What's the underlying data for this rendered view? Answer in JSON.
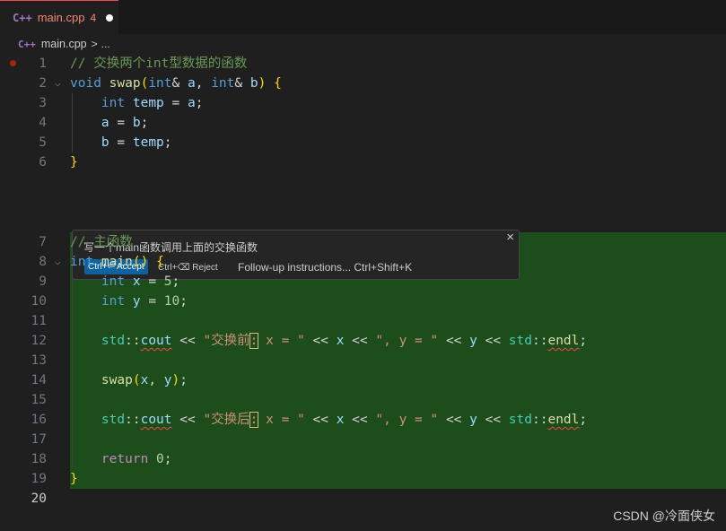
{
  "tab": {
    "icon": "C++",
    "filename": "main.cpp",
    "problem_count": "4"
  },
  "breadcrumb": {
    "icon": "C++",
    "file": "main.cpp",
    "separator": ">",
    "more": "..."
  },
  "line_numbers": [
    "1",
    "2",
    "3",
    "4",
    "5",
    "6",
    "7",
    "8",
    "9",
    "10",
    "11",
    "12",
    "13",
    "14",
    "15",
    "16",
    "17",
    "18",
    "19",
    "20"
  ],
  "code": {
    "l1_comment": "// 交换两个int型数据的函数",
    "l2_void": "void",
    "l2_swap": "swap",
    "l2_open": "(",
    "l2_int1": "int",
    "l2_amp1": "& ",
    "l2_a": "a",
    "l2_comma": ", ",
    "l2_int2": "int",
    "l2_amp2": "& ",
    "l2_b": "b",
    "l2_close": ")",
    "l2_brace": "{",
    "l3_int": "int",
    "l3_temp": "temp",
    "l3_eq": " = ",
    "l3_a": "a",
    "l3_semi": ";",
    "l4_a": "a",
    "l4_eq": " = ",
    "l4_b": "b",
    "l4_semi": ";",
    "l5_b": "b",
    "l5_eq": " = ",
    "l5_temp": "temp",
    "l5_semi": ";",
    "l6_brace": "}",
    "l7_comment": "// 主函数",
    "l8_int": "int",
    "l8_main": "main",
    "l8_parens": "()",
    "l8_brace": "{",
    "l9_int": "int",
    "l9_x": "x",
    "l9_eq": " = ",
    "l9_num": "5",
    "l9_semi": ";",
    "l10_int": "int",
    "l10_y": "y",
    "l10_eq": " = ",
    "l10_num": "10",
    "l10_semi": ";",
    "l12_std": "std",
    "l12_colons": "::",
    "l12_cout": "cout",
    "l12_op1": " << ",
    "l12_str1a": "\"交换前",
    "l12_str1hl": ":",
    "l12_str1b": " x = \"",
    "l12_op2": " << ",
    "l12_x": "x",
    "l12_op3": " << ",
    "l12_str2": "\", y = \"",
    "l12_op4": " << ",
    "l12_y": "y",
    "l12_op5": " << ",
    "l12_std2": "std",
    "l12_colons2": "::",
    "l12_endl": "endl",
    "l12_semi": ";",
    "l14_swap": "swap",
    "l14_open": "(",
    "l14_x": "x",
    "l14_comma": ", ",
    "l14_y": "y",
    "l14_close": ")",
    "l14_semi": ";",
    "l16_std": "std",
    "l16_colons": "::",
    "l16_cout": "cout",
    "l16_op1": " << ",
    "l16_str1a": "\"交换后",
    "l16_str1hl": ":",
    "l16_str1b": " x = \"",
    "l16_op2": " << ",
    "l16_x": "x",
    "l16_op3": " << ",
    "l16_str2": "\", y = \"",
    "l16_op4": " << ",
    "l16_y": "y",
    "l16_op5": " << ",
    "l16_std2": "std",
    "l16_colons2": "::",
    "l16_endl": "endl",
    "l16_semi": ";",
    "l18_return": "return",
    "l18_num": "0",
    "l18_semi": ";",
    "l19_brace": "}"
  },
  "inline_chat": {
    "prompt": "写一个main函数调用上面的交换函数",
    "accept_label": "Ctrl+⏎ Accept",
    "reject_label": "Ctrl+⌫ Reject",
    "followup_label": "Follow-up instructions... Ctrl+Shift+K",
    "close_glyph": "×"
  },
  "watermark": "CSDN @冷面侠女",
  "colors": {
    "accent_error": "#f14c4c",
    "accept_button": "#0e639c",
    "inserted_block_bg": "#1d4d1b"
  }
}
